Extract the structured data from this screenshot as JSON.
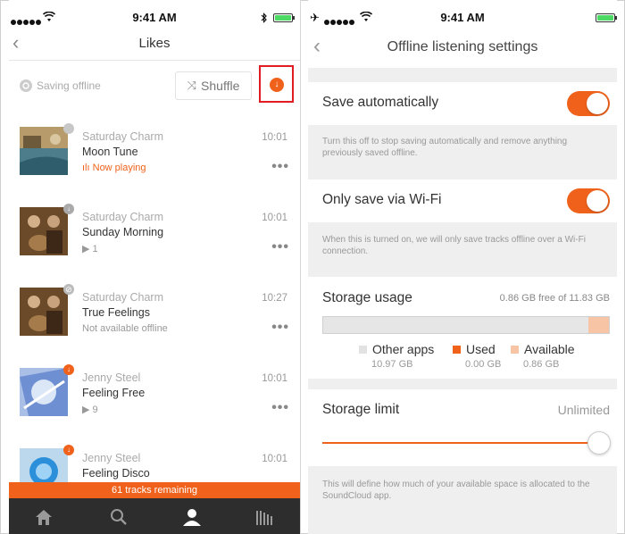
{
  "status_bar": {
    "time": "9:41 AM"
  },
  "left": {
    "nav": {
      "back_icon": "chevron-left-icon",
      "title": "Likes"
    },
    "saving_label": "Saving offline",
    "shuffle_label": "Shuffle",
    "tracks": [
      {
        "artist": "Saturday Charm",
        "title": "Moon Tune",
        "time": "10:01",
        "sub": "Now playing",
        "sub_kind": "playing",
        "badge": "sync"
      },
      {
        "artist": "Saturday Charm",
        "title": "Sunday Morning",
        "time": "10:01",
        "sub": "▶ 1",
        "sub_kind": "plays",
        "badge": "downloaded"
      },
      {
        "artist": "Saturday Charm",
        "title": "True Feelings",
        "time": "10:27",
        "sub": "Not available offline",
        "sub_kind": "unavailable",
        "badge": "blocked"
      },
      {
        "artist": "Jenny Steel",
        "title": "Feeling Free",
        "time": "10:01",
        "sub": "▶ 9",
        "sub_kind": "plays",
        "badge": "download"
      },
      {
        "artist": "Jenny Steel",
        "title": "Feeling Disco",
        "time": "10:01",
        "sub": "",
        "sub_kind": "",
        "badge": "download"
      }
    ],
    "more_label": "•••",
    "remaining_label": "61 tracks remaining",
    "tabs": [
      "home-icon",
      "search-icon",
      "profile-icon",
      "library-icon"
    ],
    "accent": "#f0621b"
  },
  "right": {
    "nav": {
      "title": "Offline listening settings"
    },
    "save_auto": {
      "label": "Save automatically",
      "on": true,
      "note": "Turn this off to stop saving automatically and remove anything previously saved offline."
    },
    "wifi_only": {
      "label": "Only save via Wi-Fi",
      "on": true,
      "note": "When this is turned on, we will only save tracks offline over a Wi-Fi connection."
    },
    "storage": {
      "label": "Storage usage",
      "free_text": "0.86 GB free of 11.83 GB",
      "other_label": "Other apps",
      "other_value": "10.97 GB",
      "other_fraction": 0.927,
      "used_label": "Used",
      "used_value": "0.00 GB",
      "used_fraction": 0.0,
      "available_label": "Available",
      "available_value": "0.86 GB",
      "available_fraction": 0.073
    },
    "limit": {
      "label": "Storage limit",
      "value": "Unlimited",
      "slider_fraction": 1.0,
      "note": "This will define how much of your available space is allocated to the SoundCloud app."
    }
  }
}
